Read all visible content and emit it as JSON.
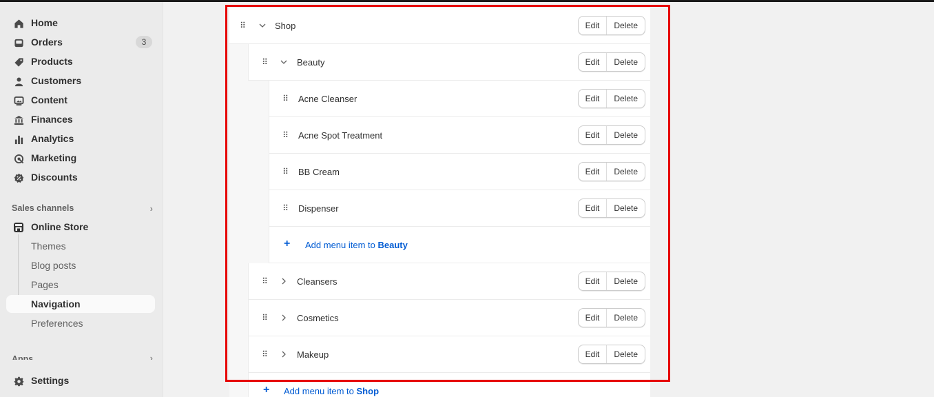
{
  "sidebar": {
    "main_items": [
      {
        "label": "Home",
        "icon": "home-icon"
      },
      {
        "label": "Orders",
        "icon": "inbox-icon",
        "badge": "3"
      },
      {
        "label": "Products",
        "icon": "tag-icon"
      },
      {
        "label": "Customers",
        "icon": "person-icon"
      },
      {
        "label": "Content",
        "icon": "image-icon"
      },
      {
        "label": "Finances",
        "icon": "bank-icon"
      },
      {
        "label": "Analytics",
        "icon": "bar-chart-icon"
      },
      {
        "label": "Marketing",
        "icon": "target-icon"
      },
      {
        "label": "Discounts",
        "icon": "discount-icon"
      }
    ],
    "sales_channels_label": "Sales channels",
    "online_store_label": "Online Store",
    "online_store_subitems": [
      "Themes",
      "Blog posts",
      "Pages",
      "Navigation",
      "Preferences"
    ],
    "active_subitem": "Navigation",
    "apps_label": "Apps",
    "settings_label": "Settings"
  },
  "menu": {
    "edit_label": "Edit",
    "delete_label": "Delete",
    "top_item": "Shop",
    "beauty_item": "Beauty",
    "beauty_children": [
      "Acne Cleanser",
      "Acne Spot Treatment",
      "BB Cream",
      "Dispenser"
    ],
    "add_beauty_prefix": "Add menu item to",
    "add_beauty_target": "Beauty",
    "collapsed_items": [
      "Cleansers",
      "Cosmetics",
      "Makeup"
    ],
    "add_shop_prefix": "Add menu item to",
    "add_shop_target": "Shop"
  },
  "colors": {
    "accent_link": "#005bd3",
    "highlight_box": "#e60000"
  }
}
